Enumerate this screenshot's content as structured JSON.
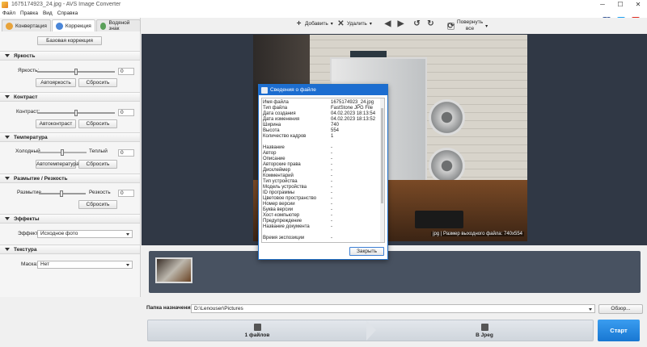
{
  "window": {
    "title": "1675174923_24.jpg - AVS Image Converter",
    "min": "─",
    "max": "☐",
    "close": "✕"
  },
  "menu": [
    "Файл",
    "Правка",
    "Вид",
    "Справка"
  ],
  "tabs": [
    {
      "label": "Конвертация"
    },
    {
      "label": "Коррекция"
    },
    {
      "label": "Водяной знак"
    }
  ],
  "left": {
    "basic_btn": "Базовая коррекция",
    "brightness": {
      "title": "Яркость",
      "label": "Яркость:",
      "value": "0",
      "auto": "Автояркость",
      "reset": "Сбросить"
    },
    "contrast": {
      "title": "Контраст",
      "label": "Контраст:",
      "value": "0",
      "auto": "Автоконтраст",
      "reset": "Сбросить"
    },
    "temperature": {
      "title": "Температура",
      "cold": "Холодный",
      "warm": "Теплый",
      "value": "0",
      "auto": "Автотемпература",
      "reset": "Сбросить"
    },
    "blur": {
      "title": "Размытие / Резкость",
      "blur_lbl": "Размытие",
      "sharp_lbl": "Резкость",
      "value": "0",
      "reset": "Сбросить"
    },
    "effects": {
      "title": "Эффекты",
      "label": "Эффект:",
      "value": "Исходное фото"
    },
    "texture": {
      "title": "Текстура",
      "label": "Маска:",
      "value": "Нет"
    }
  },
  "toolbar": {
    "add": "Добавить",
    "delete": "Удалить",
    "rotate_all_1": "Повернуть",
    "rotate_all_2": "все"
  },
  "viewer": {
    "status": "jpg | Размер выходного файла: 740x554"
  },
  "dialog": {
    "title": "Сведения о файле",
    "rows": [
      {
        "k": "Имя файла",
        "v": "1675174923_24.jpg"
      },
      {
        "k": "Тип файла",
        "v": "FastStone JPG File"
      },
      {
        "k": "Дата создания",
        "v": "04.02.2023 18:13:54"
      },
      {
        "k": "Дата изменения",
        "v": "04.02.2023 18:13:52"
      },
      {
        "k": "Ширина",
        "v": "740"
      },
      {
        "k": "Высота",
        "v": "554"
      },
      {
        "k": "Количество кадров",
        "v": "1"
      },
      {
        "k": "",
        "v": ""
      },
      {
        "k": "Название",
        "v": "-"
      },
      {
        "k": "Автор",
        "v": "-"
      },
      {
        "k": "Описание",
        "v": "-"
      },
      {
        "k": "Авторские права",
        "v": "-"
      },
      {
        "k": "Дисклеймер",
        "v": "-"
      },
      {
        "k": "Комментарий",
        "v": "-"
      },
      {
        "k": "Тип устройства",
        "v": "-"
      },
      {
        "k": "Модель устройства",
        "v": "-"
      },
      {
        "k": "ID программы",
        "v": "-"
      },
      {
        "k": "Цветовое пространство",
        "v": "-"
      },
      {
        "k": "Номер версии",
        "v": "-"
      },
      {
        "k": "Буква версии",
        "v": "-"
      },
      {
        "k": "Хост-компьютер",
        "v": "-"
      },
      {
        "k": "Предупреждение",
        "v": "-"
      },
      {
        "k": "Название документа",
        "v": "-"
      },
      {
        "k": "",
        "v": ""
      },
      {
        "k": "Время экспозиции",
        "v": "-"
      }
    ],
    "close": "Закрыть"
  },
  "destination": {
    "label": "Папка назначения:",
    "path": "D:\\Lenouser\\Pictures",
    "browse": "Обзор..."
  },
  "bottom": {
    "files": "1 файлов",
    "format": "В Jpeg",
    "start": "Старт"
  },
  "colors": {
    "accent": "#1c6dd0",
    "viewer_bg": "#303845",
    "strip_bg": "#485261",
    "start_btn": "#2a8be6"
  }
}
